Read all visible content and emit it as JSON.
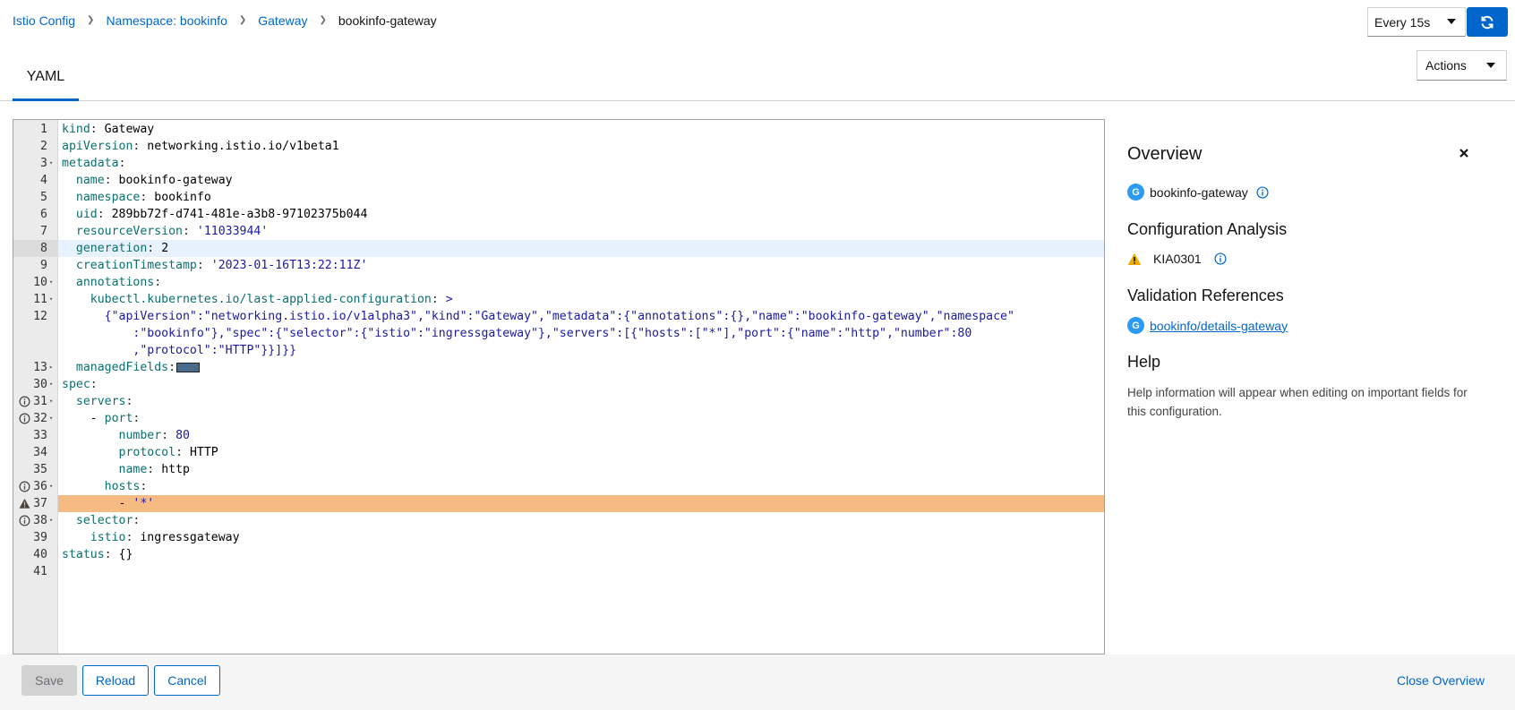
{
  "breadcrumb": {
    "items": [
      "Istio Config",
      "Namespace: bookinfo",
      "Gateway"
    ],
    "current": "bookinfo-gateway"
  },
  "refresh": {
    "interval": "Every 15s"
  },
  "tabs": [
    {
      "label": "YAML"
    }
  ],
  "actions": {
    "label": "Actions"
  },
  "editor": {
    "lines": [
      {
        "n": "1",
        "fold": "",
        "mark": "",
        "tokens": [
          [
            "k",
            "kind"
          ],
          [
            "p",
            ": "
          ],
          [
            "v",
            "Gateway"
          ]
        ]
      },
      {
        "n": "2",
        "fold": "",
        "mark": "",
        "tokens": [
          [
            "k",
            "apiVersion"
          ],
          [
            "p",
            ": "
          ],
          [
            "v",
            "networking.istio.io/v1beta1"
          ]
        ]
      },
      {
        "n": "3",
        "fold": "▾",
        "mark": "",
        "tokens": [
          [
            "k",
            "metadata"
          ],
          [
            "p",
            ":"
          ]
        ]
      },
      {
        "n": "4",
        "fold": "",
        "mark": "",
        "tokens": [
          [
            "v",
            "  "
          ],
          [
            "k",
            "name"
          ],
          [
            "p",
            ": "
          ],
          [
            "v",
            "bookinfo-gateway"
          ]
        ]
      },
      {
        "n": "5",
        "fold": "",
        "mark": "",
        "tokens": [
          [
            "v",
            "  "
          ],
          [
            "k",
            "namespace"
          ],
          [
            "p",
            ": "
          ],
          [
            "v",
            "bookinfo"
          ]
        ]
      },
      {
        "n": "6",
        "fold": "",
        "mark": "",
        "tokens": [
          [
            "v",
            "  "
          ],
          [
            "k",
            "uid"
          ],
          [
            "p",
            ": "
          ],
          [
            "v",
            "289bb72f-d741-481e-a3b8-97102375b044"
          ]
        ]
      },
      {
        "n": "7",
        "fold": "",
        "mark": "",
        "tokens": [
          [
            "v",
            "  "
          ],
          [
            "k",
            "resourceVersion"
          ],
          [
            "p",
            ": "
          ],
          [
            "s",
            "'11033944'"
          ]
        ]
      },
      {
        "n": "8",
        "fold": "",
        "mark": "",
        "active": true,
        "tokens": [
          [
            "v",
            "  "
          ],
          [
            "k",
            "generation"
          ],
          [
            "p",
            ": "
          ],
          [
            "v",
            "2"
          ]
        ]
      },
      {
        "n": "9",
        "fold": "",
        "mark": "",
        "tokens": [
          [
            "v",
            "  "
          ],
          [
            "k",
            "creationTimestamp"
          ],
          [
            "p",
            ": "
          ],
          [
            "s",
            "'2023-01-16T13:22:11Z'"
          ]
        ]
      },
      {
        "n": "10",
        "fold": "▾",
        "mark": "",
        "tokens": [
          [
            "v",
            "  "
          ],
          [
            "k",
            "annotations"
          ],
          [
            "p",
            ":"
          ]
        ]
      },
      {
        "n": "11",
        "fold": "▾",
        "mark": "",
        "tokens": [
          [
            "v",
            "    "
          ],
          [
            "k",
            "kubectl.kubernetes.io/last-applied-configuration"
          ],
          [
            "p",
            ": "
          ],
          [
            "s",
            ">"
          ]
        ]
      },
      {
        "n": "12",
        "fold": "",
        "mark": "",
        "tokens": [
          [
            "v",
            "      "
          ],
          [
            "s",
            "{\"apiVersion\":\"networking.istio.io/v1alpha3\",\"kind\":\"Gateway\",\"metadata\":{\"annotations\":{},\"name\":\"bookinfo-gateway\",\"namespace\""
          ]
        ]
      },
      {
        "n": "",
        "fold": "",
        "mark": "",
        "tokens": [
          [
            "v",
            "          "
          ],
          [
            "s",
            ":\"bookinfo\"},\"spec\":{\"selector\":{\"istio\":\"ingressgateway\"},\"servers\":[{\"hosts\":[\"*\"],\"port\":{\"name\":\"http\",\"number\":80"
          ]
        ]
      },
      {
        "n": "",
        "fold": "",
        "mark": "",
        "tokens": [
          [
            "v",
            "          "
          ],
          [
            "s",
            ",\"protocol\":\"HTTP\"}}]}}"
          ]
        ]
      },
      {
        "n": "13",
        "fold": "▸",
        "mark": "",
        "box": true,
        "tokens": [
          [
            "v",
            "  "
          ],
          [
            "k",
            "managedFields"
          ],
          [
            "p",
            ":"
          ]
        ]
      },
      {
        "n": "30",
        "fold": "▾",
        "mark": "",
        "tokens": [
          [
            "k",
            "spec"
          ],
          [
            "p",
            ":"
          ]
        ]
      },
      {
        "n": "31",
        "fold": "▾",
        "mark": "info",
        "tokens": [
          [
            "v",
            "  "
          ],
          [
            "k",
            "servers"
          ],
          [
            "p",
            ":"
          ]
        ]
      },
      {
        "n": "32",
        "fold": "▾",
        "mark": "info",
        "tokens": [
          [
            "v",
            "    - "
          ],
          [
            "k",
            "port"
          ],
          [
            "p",
            ":"
          ]
        ]
      },
      {
        "n": "33",
        "fold": "",
        "mark": "",
        "tokens": [
          [
            "v",
            "        "
          ],
          [
            "k",
            "number"
          ],
          [
            "p",
            ": "
          ],
          [
            "s",
            "80"
          ]
        ]
      },
      {
        "n": "34",
        "fold": "",
        "mark": "",
        "tokens": [
          [
            "v",
            "        "
          ],
          [
            "k",
            "protocol"
          ],
          [
            "p",
            ": "
          ],
          [
            "v",
            "HTTP"
          ]
        ]
      },
      {
        "n": "35",
        "fold": "",
        "mark": "",
        "tokens": [
          [
            "v",
            "        "
          ],
          [
            "k",
            "name"
          ],
          [
            "p",
            ": "
          ],
          [
            "v",
            "http"
          ]
        ]
      },
      {
        "n": "36",
        "fold": "▾",
        "mark": "info",
        "tokens": [
          [
            "v",
            "      "
          ],
          [
            "k",
            "hosts"
          ],
          [
            "p",
            ":"
          ]
        ]
      },
      {
        "n": "37",
        "fold": "",
        "mark": "warn",
        "warn": true,
        "tokens": [
          [
            "v",
            "        - "
          ],
          [
            "s",
            "'*'"
          ]
        ]
      },
      {
        "n": "38",
        "fold": "▾",
        "mark": "info",
        "tokens": [
          [
            "v",
            "  "
          ],
          [
            "k",
            "selector"
          ],
          [
            "p",
            ":"
          ]
        ]
      },
      {
        "n": "39",
        "fold": "",
        "mark": "",
        "tokens": [
          [
            "v",
            "    "
          ],
          [
            "k",
            "istio"
          ],
          [
            "p",
            ": "
          ],
          [
            "v",
            "ingressgateway"
          ]
        ]
      },
      {
        "n": "40",
        "fold": "",
        "mark": "",
        "tokens": [
          [
            "k",
            "status"
          ],
          [
            "p",
            ": "
          ],
          [
            "v",
            "{}"
          ]
        ]
      },
      {
        "n": "41",
        "fold": "",
        "mark": "",
        "tokens": []
      }
    ]
  },
  "overview": {
    "title": "Overview",
    "resource_badge": "G",
    "resource_name": "bookinfo-gateway",
    "config_analysis_title": "Configuration Analysis",
    "analysis_code": "KIA0301",
    "validation_title": "Validation References",
    "validation_badge": "G",
    "validation_link": "bookinfo/details-gateway",
    "help_title": "Help",
    "help_text": "Help information will appear when editing on important fields for this configuration."
  },
  "footer": {
    "save": "Save",
    "reload": "Reload",
    "cancel": "Cancel",
    "close_overview": "Close Overview"
  },
  "colors": {
    "primary": "#0066cc",
    "warning_line": "#f5bb82",
    "badge": "#2b9af3",
    "warning_icon": "#f0ab00"
  }
}
